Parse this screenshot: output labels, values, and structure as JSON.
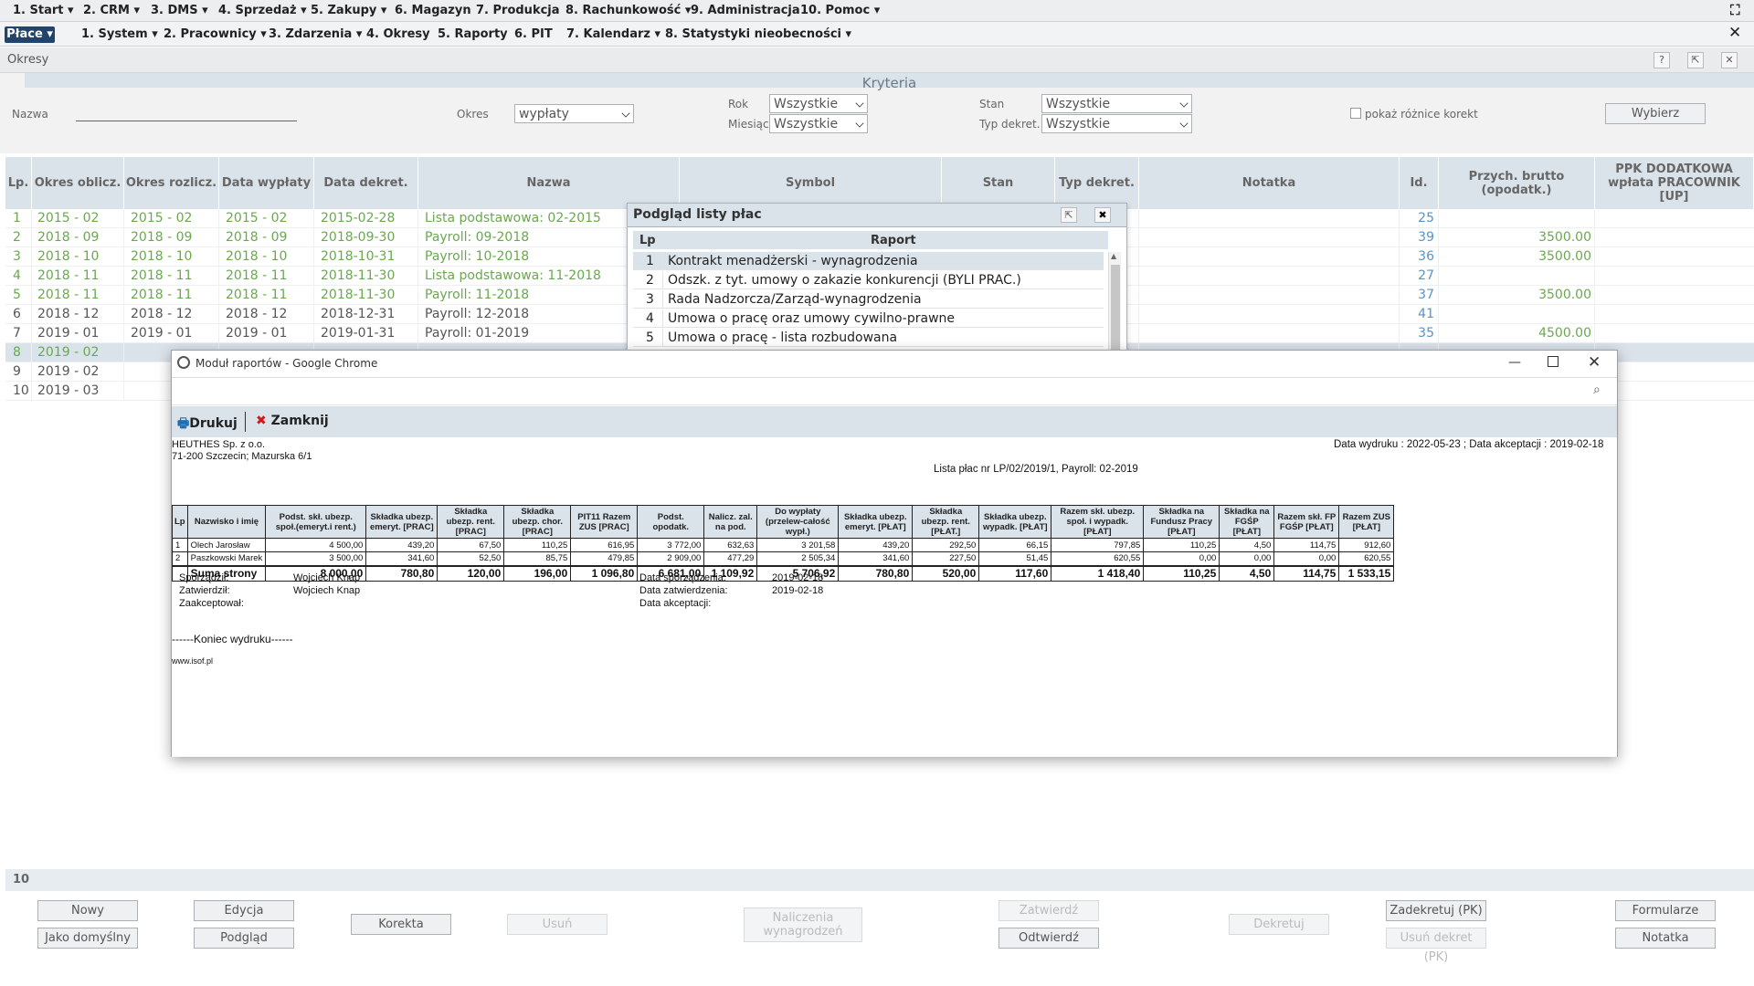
{
  "menu_main": [
    "1. Start",
    "2. CRM",
    "3. DMS",
    "4. Sprzedaż",
    "5. Zakupy",
    "6. Magazyn",
    "7. Produkcja",
    "8. Rachunkowość",
    "9. Administracja",
    "10. Pomoc"
  ],
  "module_label": "Płace",
  "menu_sub": [
    "1. System",
    "2. Pracownicy",
    "3. Zdarzenia",
    "4. Okresy",
    "5. Raporty",
    "6. PIT",
    "7. Kalendarz",
    "8. Statystyki nieobecności"
  ],
  "page_title": "Okresy",
  "criteria": {
    "heading": "Kryteria",
    "nazwa_label": "Nazwa",
    "okres_label": "Okres",
    "okres_value": "wypłaty",
    "rok_label": "Rok",
    "rok_value": "Wszystkie",
    "miesiac_label": "Miesiąc",
    "miesiac_value": "Wszystkie",
    "stan_label": "Stan",
    "stan_value": "Wszystkie",
    "typ_label": "Typ dekret.",
    "typ_value": "Wszystkie",
    "korekty_label": "pokaż różnice korekt",
    "wybierz_label": "Wybierz"
  },
  "grid": {
    "headers": [
      "Lp.",
      "Okres oblicz.",
      "Okres rozlicz.",
      "Data wypłaty",
      "Data dekret.",
      "Nazwa",
      "Symbol",
      "Stan",
      "Typ dekret.",
      "Notatka",
      "Id.",
      "Przych. brutto (opodatk.)",
      "PPK DODATKOWA wpłata PRACOWNIK [UP]"
    ],
    "rows": [
      {
        "lp": "1",
        "oblicz": "2015 - 02",
        "rozlicz": "2015 - 02",
        "wyplaty": "2015 - 02",
        "dekret": "2015-02-28",
        "nazwa": "Lista podstawowa: 02-2015",
        "id": "25",
        "brutto": ""
      },
      {
        "lp": "2",
        "oblicz": "2018 - 09",
        "rozlicz": "2018 - 09",
        "wyplaty": "2018 - 09",
        "dekret": "2018-09-30",
        "nazwa": "Payroll: 09-2018",
        "id": "39",
        "brutto": "3500.00"
      },
      {
        "lp": "3",
        "oblicz": "2018 - 10",
        "rozlicz": "2018 - 10",
        "wyplaty": "2018 - 10",
        "dekret": "2018-10-31",
        "nazwa": "Payroll: 10-2018",
        "id": "36",
        "brutto": "3500.00"
      },
      {
        "lp": "4",
        "oblicz": "2018 - 11",
        "rozlicz": "2018 - 11",
        "wyplaty": "2018 - 11",
        "dekret": "2018-11-30",
        "nazwa": "Lista podstawowa: 11-2018",
        "id": "27",
        "brutto": ""
      },
      {
        "lp": "5",
        "oblicz": "2018 - 11",
        "rozlicz": "2018 - 11",
        "wyplaty": "2018 - 11",
        "dekret": "2018-11-30",
        "nazwa": "Payroll: 11-2018",
        "id": "37",
        "brutto": "3500.00"
      },
      {
        "lp": "6",
        "oblicz": "2018 - 12",
        "rozlicz": "2018 - 12",
        "wyplaty": "2018 - 12",
        "dekret": "2018-12-31",
        "nazwa": "Payroll: 12-2018",
        "id": "41",
        "brutto": ""
      },
      {
        "lp": "7",
        "oblicz": "2019 - 01",
        "rozlicz": "2019 - 01",
        "wyplaty": "2019 - 01",
        "dekret": "2019-01-31",
        "nazwa": "Payroll: 01-2019",
        "id": "35",
        "brutto": "4500.00"
      },
      {
        "lp": "8",
        "oblicz": "2019 - 02",
        "rozlicz": "",
        "wyplaty": "",
        "dekret": "",
        "nazwa": "",
        "id": "",
        "brutto": ""
      },
      {
        "lp": "9",
        "oblicz": "2019 - 02",
        "rozlicz": "",
        "wyplaty": "",
        "dekret": "",
        "nazwa": "",
        "id": "",
        "brutto": ""
      },
      {
        "lp": "10",
        "oblicz": "2019 - 03",
        "rozlicz": "",
        "wyplaty": "",
        "dekret": "",
        "nazwa": "",
        "id": "",
        "brutto": ""
      }
    ],
    "row_count": "10"
  },
  "popup": {
    "title": "Podgląd listy płac",
    "col_lp": "Lp",
    "col_raport": "Raport",
    "rows": [
      {
        "lp": "1",
        "raport": "Kontrakt menadżerski - wynagrodzenia"
      },
      {
        "lp": "2",
        "raport": "Odszk. z tyt. umowy o zakazie konkurencji (BYLI PRAC.)"
      },
      {
        "lp": "3",
        "raport": "Rada Nadzorcza/Zarząd-wynagrodzenia"
      },
      {
        "lp": "4",
        "raport": "Umowa o pracę oraz umowy cywilno-prawne"
      },
      {
        "lp": "5",
        "raport": "Umowa o pracę - lista rozbudowana"
      }
    ]
  },
  "chrome": {
    "window_title": "Moduł raportów - Google Chrome",
    "print_label": "Drukuj",
    "close_label": "Zamknij"
  },
  "report": {
    "company": "HEUTHES Sp. z o.o.",
    "address": "71-200 Szczecin;  Mazurska 6/1",
    "dates": "Data wydruku : 2022-05-23 ;  Data akceptacji : 2019-02-18",
    "list_title": "Lista płac nr LP/02/2019/1, Payroll: 02-2019",
    "headers": [
      "Lp",
      "Nazwisko i imię",
      "Podst. skł. ubezp. społ.(emeryt.i rent.)",
      "Składka ubezp. emeryt. [PRAC]",
      "Składka ubezp. rent. [PRAC]",
      "Składka ubezp. chor. [PRAC]",
      "PIT11 Razem ZUS [PRAC]",
      "Podst. opodatk.",
      "Nalicz. zal. na pod.",
      "Do wypłaty (przelew-całość wypł.)",
      "Składka ubezp. emeryt. [PŁAT]",
      "Składka ubezp. rent. [PŁAT.]",
      "Składka ubezp. wypadk. [PŁAT]",
      "Razem skł. ubezp. społ. i wypadk. [PŁAT]",
      "Składka na Fundusz Pracy [PŁAT]",
      "Składka na FGŚP [PŁAT]",
      "Razem skł. FP FGŚP [PŁAT]",
      "Razem ZUS [PŁAT]"
    ],
    "rows": [
      [
        "1",
        "Olech Jarosław",
        "4 500,00",
        "439,20",
        "67,50",
        "110,25",
        "616,95",
        "3 772,00",
        "632,63",
        "3 201,58",
        "439,20",
        "292,50",
        "66,15",
        "797,85",
        "110,25",
        "4,50",
        "114,75",
        "912,60"
      ],
      [
        "2",
        "Paszkowski Marek",
        "3 500,00",
        "341,60",
        "52,50",
        "85,75",
        "479,85",
        "2 909,00",
        "477,29",
        "2 505,34",
        "341,60",
        "227,50",
        "51,45",
        "620,55",
        "0,00",
        "0,00",
        "0,00",
        "620,55"
      ]
    ],
    "sum_label": "Suma strony",
    "sum": [
      "8 000,00",
      "780,80",
      "120,00",
      "196,00",
      "1 096,80",
      "6 681,00",
      "1 109,92",
      "5 706,92",
      "780,80",
      "520,00",
      "117,60",
      "1 418,40",
      "110,25",
      "4,50",
      "114,75",
      "1 533,15"
    ],
    "sporzadzil_label": "Sporządził:",
    "sporzadzil": "Wojciech Knap",
    "zatwierdzil_label": "Zatwierdził:",
    "zatwierdzil": "Wojciech Knap",
    "zaakceptowal_label": "Zaakceptował:",
    "data_sporz_label": "Data sporządzenia:",
    "data_sporz": "2019-02-18",
    "data_zatw_label": "Data zatwierdzenia:",
    "data_zatw": "2019-02-18",
    "data_akc_label": "Data akceptacji:",
    "end_text": "------Koniec wydruku------",
    "footer_url": "www.isof.pl"
  },
  "buttons": {
    "nowy": "Nowy",
    "jako_domyslny": "Jako domyślny",
    "edycja": "Edycja",
    "podglad": "Podgląd",
    "korekta": "Korekta",
    "usun": "Usuń",
    "naliczenia": "Naliczenia wynagrodzeń",
    "zatwierdz": "Zatwierdź",
    "odtwierdz": "Odtwierdź",
    "dekretuj": "Dekretuj",
    "zadekretuj": "Zadekretuj (PK)",
    "usun_dekret": "Usuń dekret (PK)",
    "formularze": "Formularze",
    "notatka": "Notatka"
  }
}
